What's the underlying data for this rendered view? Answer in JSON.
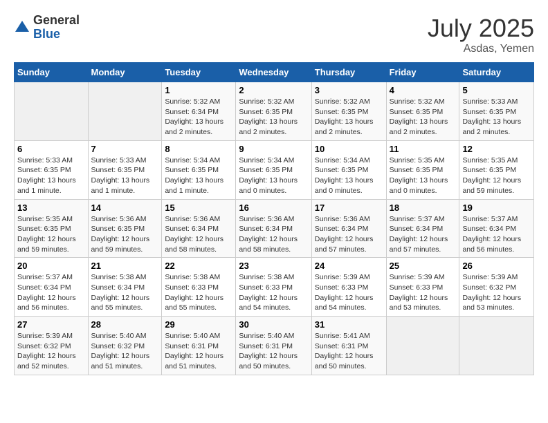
{
  "header": {
    "logo_general": "General",
    "logo_blue": "Blue",
    "month": "July 2025",
    "location": "Asdas, Yemen"
  },
  "days_of_week": [
    "Sunday",
    "Monday",
    "Tuesday",
    "Wednesday",
    "Thursday",
    "Friday",
    "Saturday"
  ],
  "weeks": [
    [
      {
        "day": "",
        "empty": true
      },
      {
        "day": "",
        "empty": true
      },
      {
        "day": "1",
        "sunrise": "Sunrise: 5:32 AM",
        "sunset": "Sunset: 6:34 PM",
        "daylight": "Daylight: 13 hours and 2 minutes."
      },
      {
        "day": "2",
        "sunrise": "Sunrise: 5:32 AM",
        "sunset": "Sunset: 6:35 PM",
        "daylight": "Daylight: 13 hours and 2 minutes."
      },
      {
        "day": "3",
        "sunrise": "Sunrise: 5:32 AM",
        "sunset": "Sunset: 6:35 PM",
        "daylight": "Daylight: 13 hours and 2 minutes."
      },
      {
        "day": "4",
        "sunrise": "Sunrise: 5:32 AM",
        "sunset": "Sunset: 6:35 PM",
        "daylight": "Daylight: 13 hours and 2 minutes."
      },
      {
        "day": "5",
        "sunrise": "Sunrise: 5:33 AM",
        "sunset": "Sunset: 6:35 PM",
        "daylight": "Daylight: 13 hours and 2 minutes."
      }
    ],
    [
      {
        "day": "6",
        "sunrise": "Sunrise: 5:33 AM",
        "sunset": "Sunset: 6:35 PM",
        "daylight": "Daylight: 13 hours and 1 minute."
      },
      {
        "day": "7",
        "sunrise": "Sunrise: 5:33 AM",
        "sunset": "Sunset: 6:35 PM",
        "daylight": "Daylight: 13 hours and 1 minute."
      },
      {
        "day": "8",
        "sunrise": "Sunrise: 5:34 AM",
        "sunset": "Sunset: 6:35 PM",
        "daylight": "Daylight: 13 hours and 1 minute."
      },
      {
        "day": "9",
        "sunrise": "Sunrise: 5:34 AM",
        "sunset": "Sunset: 6:35 PM",
        "daylight": "Daylight: 13 hours and 0 minutes."
      },
      {
        "day": "10",
        "sunrise": "Sunrise: 5:34 AM",
        "sunset": "Sunset: 6:35 PM",
        "daylight": "Daylight: 13 hours and 0 minutes."
      },
      {
        "day": "11",
        "sunrise": "Sunrise: 5:35 AM",
        "sunset": "Sunset: 6:35 PM",
        "daylight": "Daylight: 13 hours and 0 minutes."
      },
      {
        "day": "12",
        "sunrise": "Sunrise: 5:35 AM",
        "sunset": "Sunset: 6:35 PM",
        "daylight": "Daylight: 12 hours and 59 minutes."
      }
    ],
    [
      {
        "day": "13",
        "sunrise": "Sunrise: 5:35 AM",
        "sunset": "Sunset: 6:35 PM",
        "daylight": "Daylight: 12 hours and 59 minutes."
      },
      {
        "day": "14",
        "sunrise": "Sunrise: 5:36 AM",
        "sunset": "Sunset: 6:35 PM",
        "daylight": "Daylight: 12 hours and 59 minutes."
      },
      {
        "day": "15",
        "sunrise": "Sunrise: 5:36 AM",
        "sunset": "Sunset: 6:34 PM",
        "daylight": "Daylight: 12 hours and 58 minutes."
      },
      {
        "day": "16",
        "sunrise": "Sunrise: 5:36 AM",
        "sunset": "Sunset: 6:34 PM",
        "daylight": "Daylight: 12 hours and 58 minutes."
      },
      {
        "day": "17",
        "sunrise": "Sunrise: 5:36 AM",
        "sunset": "Sunset: 6:34 PM",
        "daylight": "Daylight: 12 hours and 57 minutes."
      },
      {
        "day": "18",
        "sunrise": "Sunrise: 5:37 AM",
        "sunset": "Sunset: 6:34 PM",
        "daylight": "Daylight: 12 hours and 57 minutes."
      },
      {
        "day": "19",
        "sunrise": "Sunrise: 5:37 AM",
        "sunset": "Sunset: 6:34 PM",
        "daylight": "Daylight: 12 hours and 56 minutes."
      }
    ],
    [
      {
        "day": "20",
        "sunrise": "Sunrise: 5:37 AM",
        "sunset": "Sunset: 6:34 PM",
        "daylight": "Daylight: 12 hours and 56 minutes."
      },
      {
        "day": "21",
        "sunrise": "Sunrise: 5:38 AM",
        "sunset": "Sunset: 6:34 PM",
        "daylight": "Daylight: 12 hours and 55 minutes."
      },
      {
        "day": "22",
        "sunrise": "Sunrise: 5:38 AM",
        "sunset": "Sunset: 6:33 PM",
        "daylight": "Daylight: 12 hours and 55 minutes."
      },
      {
        "day": "23",
        "sunrise": "Sunrise: 5:38 AM",
        "sunset": "Sunset: 6:33 PM",
        "daylight": "Daylight: 12 hours and 54 minutes."
      },
      {
        "day": "24",
        "sunrise": "Sunrise: 5:39 AM",
        "sunset": "Sunset: 6:33 PM",
        "daylight": "Daylight: 12 hours and 54 minutes."
      },
      {
        "day": "25",
        "sunrise": "Sunrise: 5:39 AM",
        "sunset": "Sunset: 6:33 PM",
        "daylight": "Daylight: 12 hours and 53 minutes."
      },
      {
        "day": "26",
        "sunrise": "Sunrise: 5:39 AM",
        "sunset": "Sunset: 6:32 PM",
        "daylight": "Daylight: 12 hours and 53 minutes."
      }
    ],
    [
      {
        "day": "27",
        "sunrise": "Sunrise: 5:39 AM",
        "sunset": "Sunset: 6:32 PM",
        "daylight": "Daylight: 12 hours and 52 minutes."
      },
      {
        "day": "28",
        "sunrise": "Sunrise: 5:40 AM",
        "sunset": "Sunset: 6:32 PM",
        "daylight": "Daylight: 12 hours and 51 minutes."
      },
      {
        "day": "29",
        "sunrise": "Sunrise: 5:40 AM",
        "sunset": "Sunset: 6:31 PM",
        "daylight": "Daylight: 12 hours and 51 minutes."
      },
      {
        "day": "30",
        "sunrise": "Sunrise: 5:40 AM",
        "sunset": "Sunset: 6:31 PM",
        "daylight": "Daylight: 12 hours and 50 minutes."
      },
      {
        "day": "31",
        "sunrise": "Sunrise: 5:41 AM",
        "sunset": "Sunset: 6:31 PM",
        "daylight": "Daylight: 12 hours and 50 minutes."
      },
      {
        "day": "",
        "empty": true
      },
      {
        "day": "",
        "empty": true
      }
    ]
  ]
}
